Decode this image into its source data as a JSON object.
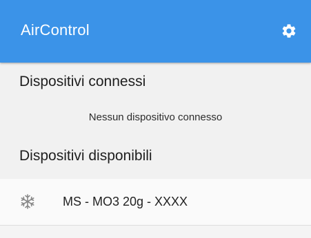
{
  "app": {
    "title": "AirControl",
    "accent_color": "#3b93e8",
    "settings_icon": "gear-icon"
  },
  "connected": {
    "title": "Dispositivi connessi",
    "empty_message": "Nessun dispositivo connesso"
  },
  "available": {
    "title": "Dispositivi disponibili",
    "devices": [
      {
        "name": "MS - MO3 20g - XXXX",
        "icon": "snowflake-icon"
      }
    ]
  }
}
